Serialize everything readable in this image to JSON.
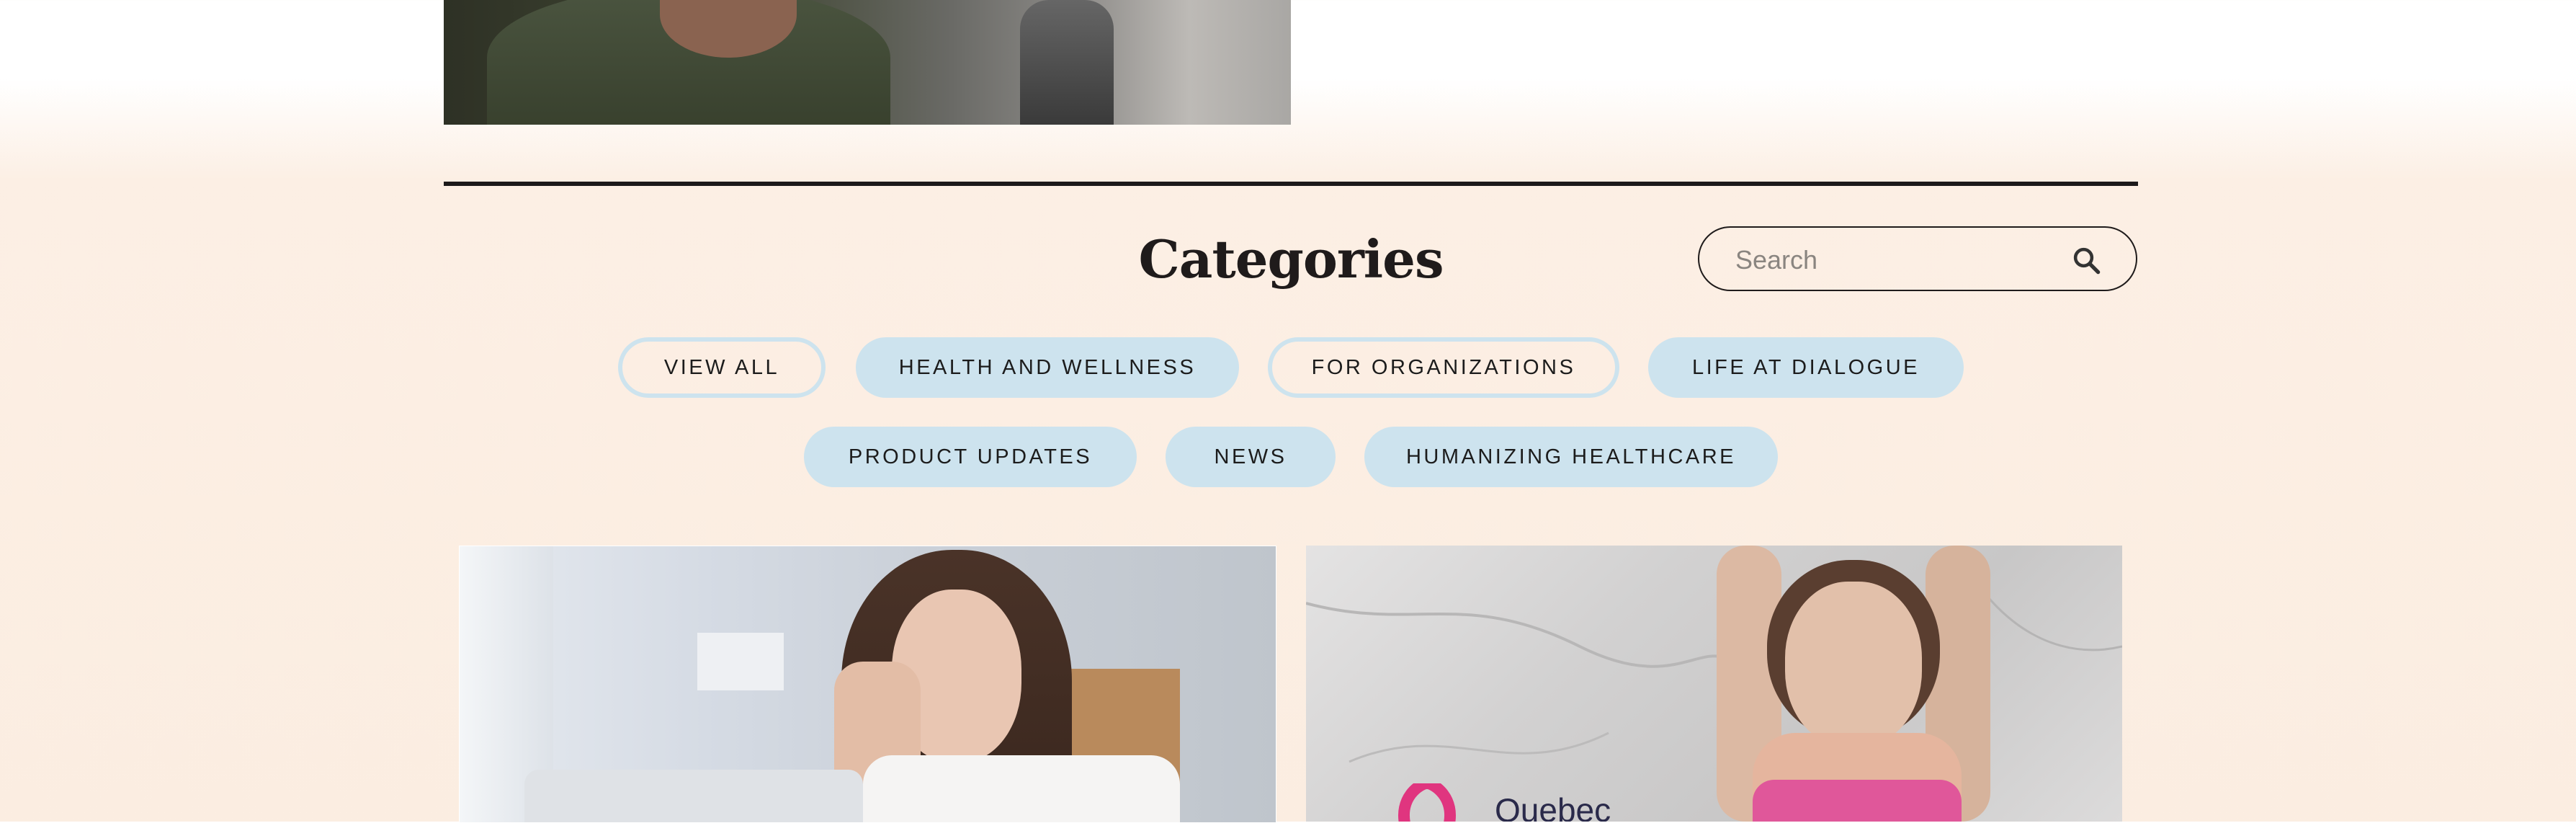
{
  "categories": {
    "title": "Categories",
    "search": {
      "placeholder": "Search",
      "icon": "search-icon"
    },
    "filters_row1": [
      {
        "label": "VIEW ALL",
        "style": "outline"
      },
      {
        "label": "HEALTH AND WELLNESS",
        "style": "filled"
      },
      {
        "label": "FOR ORGANIZATIONS",
        "style": "outline"
      },
      {
        "label": "LIFE AT DIALOGUE",
        "style": "filled"
      }
    ],
    "filters_row2": [
      {
        "label": "PRODUCT UPDATES",
        "style": "filled"
      },
      {
        "label": "NEWS",
        "style": "filled"
      },
      {
        "label": "HUMANIZING HEALTHCARE",
        "style": "filled"
      }
    ]
  },
  "cards": [
    {
      "image": "woman-with-headache-at-laptop"
    },
    {
      "image": "woman-stretching-yoga",
      "logo_text": "Quebec"
    }
  ],
  "colors": {
    "background": "#fbede1",
    "pill": "#cde3ee",
    "text": "#1c1c1c",
    "logo_pink": "#e0357f"
  }
}
